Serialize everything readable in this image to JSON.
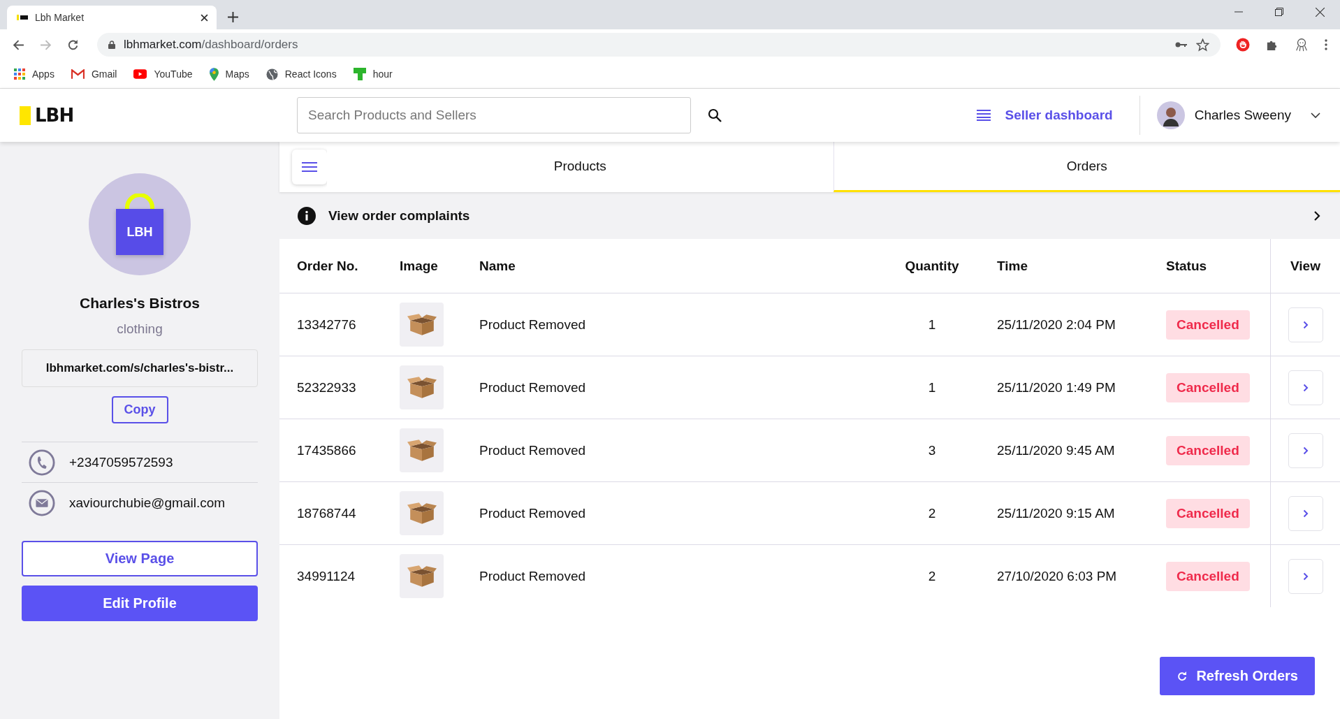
{
  "browser": {
    "tab_title": "Lbh Market",
    "url_host": "lbhmarket.com",
    "url_path": "/dashboard/orders",
    "bookmarks": [
      "Apps",
      "Gmail",
      "YouTube",
      "Maps",
      "React Icons",
      "hour"
    ]
  },
  "header": {
    "logo": "LBH",
    "search": {
      "placeholder": "Search Products and Sellers"
    },
    "seller_dashboard": "Seller dashboard",
    "user_name": "Charles Sweeny"
  },
  "sidebar": {
    "store_logo": "LBH",
    "store_name": "Charles's Bistros",
    "category": "clothing",
    "store_link": "lbhmarket.com/s/charles's-bistr...",
    "copy_button": "Copy",
    "phone": "+2347059572593",
    "email": "xaviourchubie@gmail.com",
    "view_page_button": "View Page",
    "edit_profile_button": "Edit Profile"
  },
  "tabs": [
    {
      "label": "Products",
      "selected": false
    },
    {
      "label": "Orders",
      "selected": true
    }
  ],
  "complaints_link": "View order complaints",
  "table": {
    "columns": [
      "Order No.",
      "Image",
      "Name",
      "Quantity",
      "Time",
      "Status",
      "View"
    ],
    "rows": [
      {
        "order_no": "13342776",
        "name": "Product Removed",
        "quantity": "1",
        "time": "25/11/2020 2:04 PM",
        "status": "Cancelled"
      },
      {
        "order_no": "52322933",
        "name": "Product Removed",
        "quantity": "1",
        "time": "25/11/2020 1:49 PM",
        "status": "Cancelled"
      },
      {
        "order_no": "17435866",
        "name": "Product Removed",
        "quantity": "3",
        "time": "25/11/2020 9:45 AM",
        "status": "Cancelled"
      },
      {
        "order_no": "18768744",
        "name": "Product Removed",
        "quantity": "2",
        "time": "25/11/2020 9:15 AM",
        "status": "Cancelled"
      },
      {
        "order_no": "34991124",
        "name": "Product Removed",
        "quantity": "2",
        "time": "27/10/2020 6:03 PM",
        "status": "Cancelled"
      }
    ]
  },
  "refresh_button": "Refresh Orders"
}
